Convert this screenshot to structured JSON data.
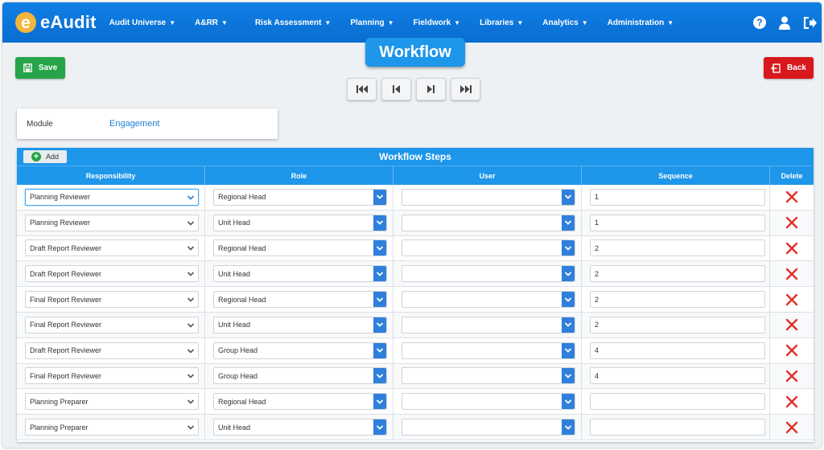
{
  "app": {
    "name": "eAudit",
    "logo_letter": "e"
  },
  "nav": {
    "items": [
      {
        "label": "Audit Universe"
      },
      {
        "label": "A&RR"
      },
      {
        "label": "Risk Assessment"
      },
      {
        "label": "Planning"
      },
      {
        "label": "Fieldwork"
      },
      {
        "label": "Libraries"
      },
      {
        "label": "Analytics"
      },
      {
        "label": "Administration"
      }
    ],
    "icons": [
      "help-icon",
      "user-icon",
      "logout-icon"
    ],
    "help_glyph": "?"
  },
  "page": {
    "title": "Workflow",
    "save_label": "Save",
    "back_label": "Back"
  },
  "pager": [
    "first-page-icon",
    "previous-page-icon",
    "next-page-icon",
    "last-page-icon"
  ],
  "module": {
    "label": "Module",
    "value": "Engagement"
  },
  "steps": {
    "title": "Workflow Steps",
    "add_label": "Add",
    "add_glyph": "+",
    "columns": [
      "Responsibility",
      "Role",
      "User",
      "Sequence",
      "Delete"
    ],
    "rows": [
      {
        "responsibility": "Planning Reviewer",
        "role": "Regional Head",
        "user": "",
        "sequence": "1"
      },
      {
        "responsibility": "Planning Reviewer",
        "role": "Unit Head",
        "user": "",
        "sequence": "1"
      },
      {
        "responsibility": "Draft Report Reviewer",
        "role": "Regional Head",
        "user": "",
        "sequence": "2"
      },
      {
        "responsibility": "Draft Report Reviewer",
        "role": "Unit Head",
        "user": "",
        "sequence": "2"
      },
      {
        "responsibility": "Final Report Reviewer",
        "role": "Regional Head",
        "user": "",
        "sequence": "2"
      },
      {
        "responsibility": "Final Report Reviewer",
        "role": "Unit Head",
        "user": "",
        "sequence": "2"
      },
      {
        "responsibility": "Draft Report Reviewer",
        "role": "Group Head",
        "user": "",
        "sequence": "4"
      },
      {
        "responsibility": "Final Report Reviewer",
        "role": "Group Head",
        "user": "",
        "sequence": "4"
      },
      {
        "responsibility": "Planning Preparer",
        "role": "Regional Head",
        "user": "",
        "sequence": ""
      },
      {
        "responsibility": "Planning Preparer",
        "role": "Unit Head",
        "user": "",
        "sequence": ""
      }
    ]
  },
  "colors": {
    "navbar": "#0a6dd0",
    "accent": "#1e96ea",
    "save": "#27a449",
    "back": "#d8181c",
    "delete": "#e0302a",
    "link": "#1e7fd4"
  }
}
